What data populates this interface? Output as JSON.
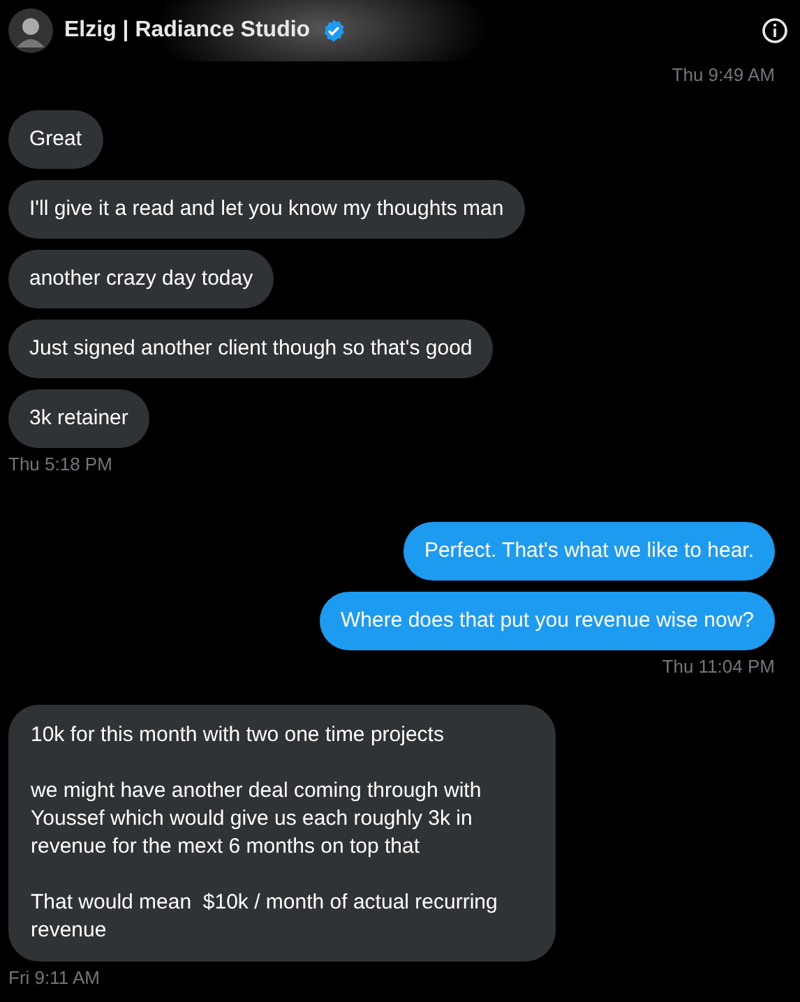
{
  "header": {
    "name": "Elzig | Radiance Studio",
    "verified": true
  },
  "top_time": "Thu 9:49 AM",
  "groups": [
    {
      "outgoing": false,
      "time": "Thu 5:18 PM",
      "messages": [
        {
          "paragraphs": [
            "Great"
          ]
        },
        {
          "paragraphs": [
            "I'll give it a read and let you know my thoughts man"
          ]
        },
        {
          "paragraphs": [
            "another crazy day today"
          ]
        },
        {
          "paragraphs": [
            "Just signed another client though so that's good"
          ]
        },
        {
          "paragraphs": [
            "3k retainer"
          ]
        }
      ]
    },
    {
      "outgoing": true,
      "time": "Thu 11:04 PM",
      "messages": [
        {
          "paragraphs": [
            "Perfect. That's what we like to hear."
          ]
        },
        {
          "paragraphs": [
            "Where does that put you revenue wise now?"
          ]
        }
      ]
    },
    {
      "outgoing": false,
      "time": "Fri 9:11 AM",
      "messages": [
        {
          "paragraphs": [
            "10k for this month with two one time projects",
            "we might have another deal coming through with Youssef which would give us each roughly 3k in revenue for the mext 6 months on top that",
            "That would mean  $10k / month of actual recurring revenue"
          ]
        }
      ]
    }
  ]
}
